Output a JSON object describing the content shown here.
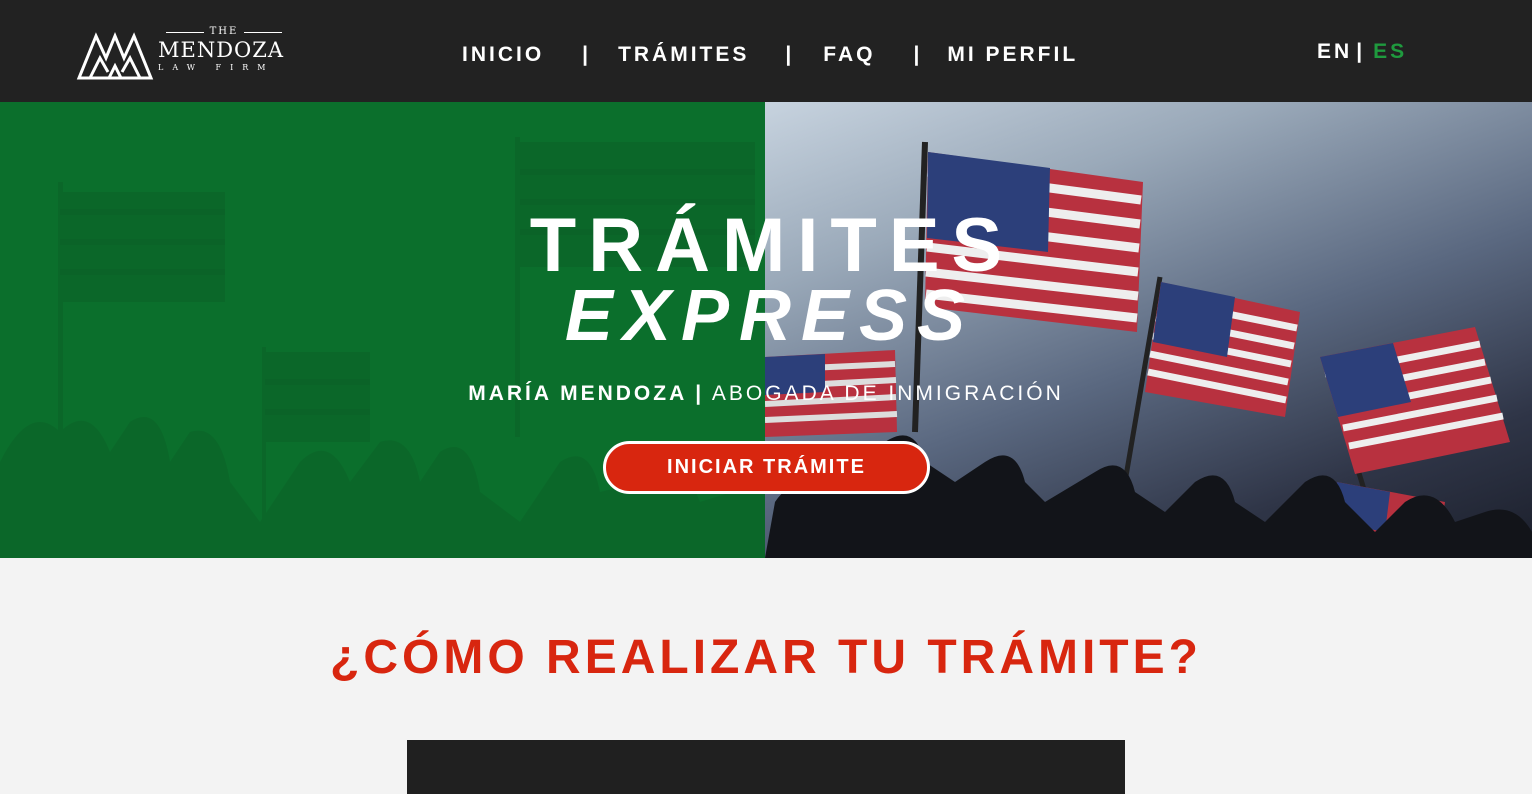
{
  "header": {
    "logo": {
      "the": "THE",
      "name": "MENDOZA",
      "sub": "LAW FIRM"
    },
    "nav": [
      "INICIO",
      "TRÁMITES",
      "FAQ",
      "MI PERFIL"
    ],
    "nav_separator": "|",
    "lang": {
      "en": "EN",
      "separator": "|",
      "es": "ES",
      "active": "ES"
    }
  },
  "hero": {
    "title_line1": "TRÁMITES",
    "title_line2": "EXPRESS",
    "subtitle_bold": "MARÍA MENDOZA |",
    "subtitle_regular": "ABOGADA DE INMIGRACIÓN",
    "cta_label": "INICIAR TRÁMITE"
  },
  "section": {
    "title": "¿CÓMO REALIZAR TU TRÁMITE?"
  },
  "colors": {
    "header_bg": "#222222",
    "brand_green": "#0b6f2c",
    "accent_red": "#d8260f",
    "lang_active": "#1f9a3e"
  }
}
